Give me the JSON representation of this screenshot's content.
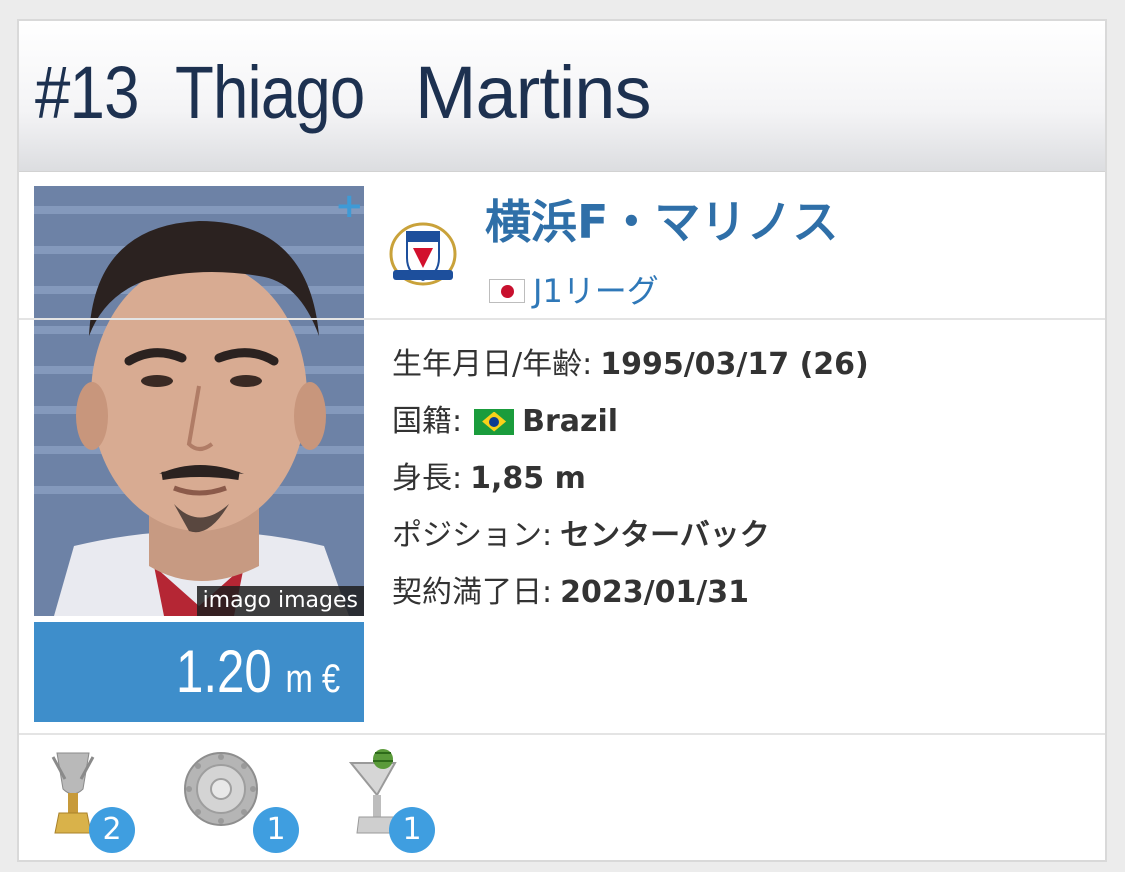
{
  "player": {
    "number": "#13",
    "first_name": "Thiago",
    "last_name": "Martins"
  },
  "photo": {
    "credit": "imago images",
    "expand_icon": "plus-icon"
  },
  "market_value": {
    "amount": "1.20",
    "unit": "m €"
  },
  "club": {
    "name": "横浜F・マリノス",
    "league": "J1リーグ",
    "league_flag": "japan-flag-icon"
  },
  "info": {
    "birth_label": "生年月日/年齢:",
    "birth_value": "1995/03/17 (26)",
    "nationality_label": "国籍:",
    "nationality_value": "Brazil",
    "height_label": "身長:",
    "height_value": "1,85 m",
    "position_label": "ポジション:",
    "position_value": "センターバック",
    "contract_label": "契約満了日:",
    "contract_value": "2023/01/31"
  },
  "trophies": [
    {
      "icon": "cup-trophy-icon",
      "count": "2"
    },
    {
      "icon": "plate-trophy-icon",
      "count": "1"
    },
    {
      "icon": "award-trophy-icon",
      "count": "1"
    }
  ],
  "colors": {
    "name": "#1d3150",
    "accent": "#3e8ecb",
    "link": "#2f6fa8",
    "badge": "#3f9ee0"
  }
}
